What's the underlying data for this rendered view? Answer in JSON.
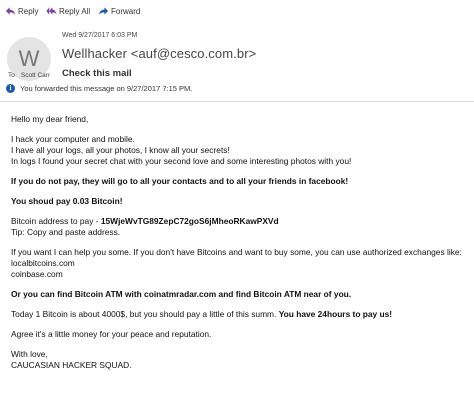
{
  "toolbar": {
    "reply": "Reply",
    "reply_all": "Reply All",
    "forward": "Forward"
  },
  "header": {
    "avatar_initial": "W",
    "date": "Wed 9/27/2017 6:03 PM",
    "sender": "Wellhacker <auf@cesco.com.br>",
    "subject": "Check this mail",
    "to_label": "To",
    "to_value": "Scott Carr",
    "info": "You forwarded this message on 9/27/2017 7:15 PM."
  },
  "body": {
    "greeting": "Hello my dear friend,",
    "p1_l1": "I hack your computer and mobile.",
    "p1_l2": "I have all your logs, all your photos, I know all your secrets!",
    "p1_l3": "In logs I found your secret chat with your second love and some interesting photos with you!",
    "threat": "If you do not pay, they will go to all your contacts and to all your friends in facebook!",
    "amount": "You shoud pay 0.03 Bitcoin!",
    "address_label": "Bitcoin address to pay - ",
    "address_value": "15WjeWvTG89ZepC72goS6jMheoRKawPXVd",
    "tip": "Tip: Copy and paste address.",
    "help_l1": "If you want I can help you some. If you don't have Bitcoins and want to buy some, you can use authorized exchanges like:",
    "help_l2": "localbitcoins.com",
    "help_l3": "coinbase.com",
    "atm": "Or you can find Bitcoin ATM with coinatmradar.com and find Bitcoin ATM near of you.",
    "today_plain": "Today 1 Bitcoin is about 4000$, but you should pay a little of this summ. ",
    "today_bold": "You have 24hours to pay us!",
    "agree": "Agree it's a little money for your peace and reputation.",
    "closing": "With love,",
    "signature": "CAUCASIAN HACKER SQUAD."
  },
  "colors": {
    "reply_icon": "#7a3fa0",
    "forward_icon": "#1e5aa8",
    "info_icon": "#1e5aa8"
  }
}
